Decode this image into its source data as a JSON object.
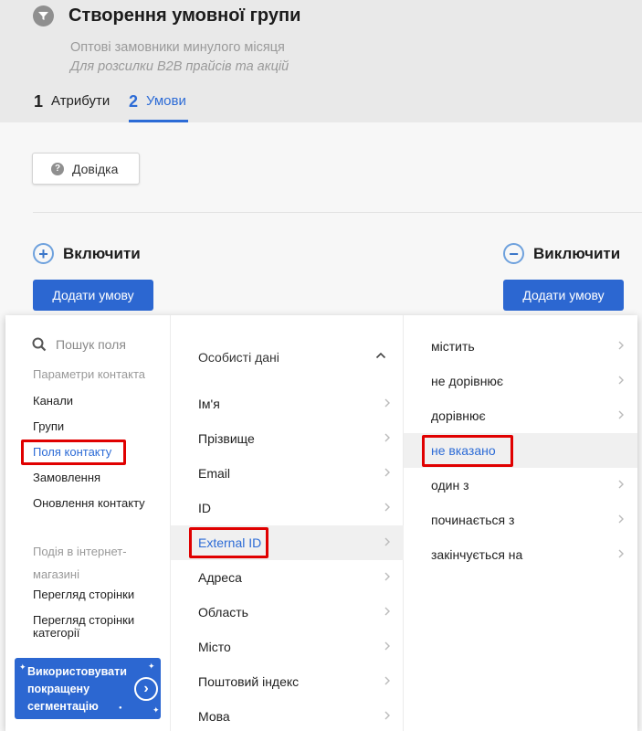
{
  "header": {
    "title": "Створення умовної групи",
    "subtitle": "Оптові замовники минулого місяця",
    "description": "Для розсилки B2B прайсів та акцій",
    "tabs": [
      {
        "num": "1",
        "label": "Атрибути"
      },
      {
        "num": "2",
        "label": "Умови"
      }
    ],
    "active_tab": "Умови"
  },
  "help_button": "Довідка",
  "include": {
    "label": "Включити",
    "add_button": "Додати умову"
  },
  "exclude": {
    "label": "Виключити",
    "add_button": "Додати умову"
  },
  "field_menu": {
    "search_placeholder": "Пошук поля",
    "groups": [
      {
        "header": "Параметри контакта",
        "items": [
          "Канали",
          "Групи",
          "Поля контакту",
          "Замовлення",
          "Оновлення контакту"
        ]
      },
      {
        "header": "Подія в інтернет-магазині",
        "items": [
          "Перегляд сторінки",
          "Перегляд сторінки категорії"
        ]
      }
    ],
    "active_item": "Поля контакту",
    "cta": "Використовувати покращену сегментацію"
  },
  "field_list": {
    "section": "Особисті дані",
    "items": [
      "Ім'я",
      "Прізвище",
      "Email",
      "ID",
      "External ID",
      "Адреса",
      "Область",
      "Місто",
      "Поштовий індекс",
      "Мова"
    ],
    "selected": "External ID"
  },
  "operators": {
    "items": [
      "містить",
      "не дорівнює",
      "дорівнює",
      "не вказано",
      "один з",
      "починається з",
      "закінчується на"
    ],
    "selected": "не вказано"
  },
  "colors": {
    "accent": "#2c67d1",
    "highlight": "#e00000",
    "header_bg": "#e9e9e9"
  }
}
